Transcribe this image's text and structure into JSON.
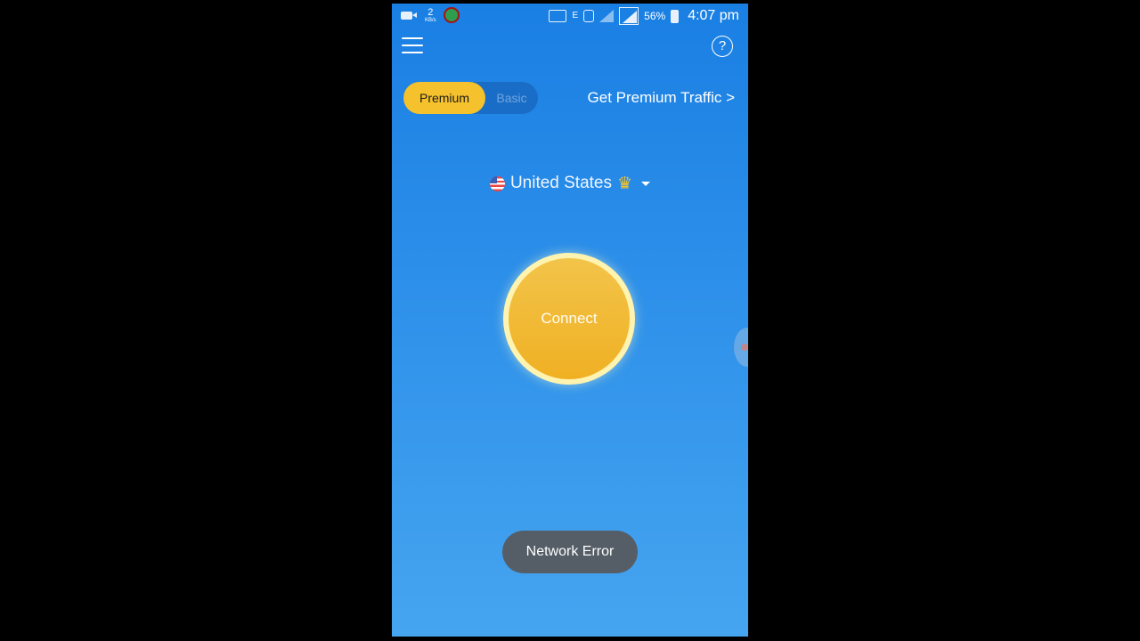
{
  "status_bar": {
    "net_speed_value": "2",
    "net_speed_unit": "KB/s",
    "network_type": "E",
    "battery": "56%",
    "time": "4:07 pm"
  },
  "toolbar": {
    "menu_icon": "hamburger-menu-icon",
    "help_icon": "?"
  },
  "plan": {
    "premium_label": "Premium",
    "basic_label": "Basic",
    "selected": "Premium"
  },
  "premium_link": "Get Premium Traffic >",
  "location": {
    "name": "United States",
    "flag": "us-flag-icon",
    "crown_icon": "♛"
  },
  "connect": {
    "label": "Connect"
  },
  "toast": {
    "message": "Network Error"
  },
  "colors": {
    "accent": "#f5c12c",
    "background_top": "#1a7fe3",
    "background_bottom": "#46a5f0",
    "toast": "#555e66"
  }
}
